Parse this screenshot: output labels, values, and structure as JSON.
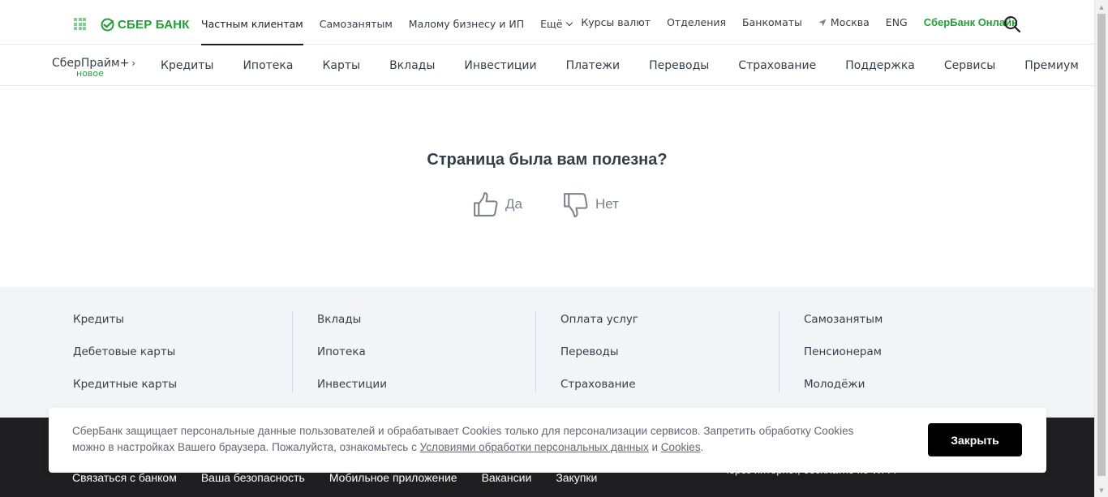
{
  "colors": {
    "brand_green": "#21a038",
    "text": "#333f48",
    "footer_bg": "#f2f4f7",
    "dark_footer_bg": "#1f1f22"
  },
  "header": {
    "logo_text": "СБЕР БАНК",
    "nav": [
      {
        "label": "Частным клиентам",
        "active": true
      },
      {
        "label": "Самозанятым"
      },
      {
        "label": "Малому бизнесу и ИП"
      },
      {
        "label": "Ещё"
      }
    ],
    "right": {
      "rates": "Курсы валют",
      "offices": "Отделения",
      "atms": "Банкоматы",
      "city": "Москва",
      "lang": "ENG",
      "online": "СберБанк Онлайн"
    },
    "icons": {
      "apps": "grid-icon",
      "search": "search-icon",
      "location": "location-arrow-icon"
    }
  },
  "product_nav": {
    "prime": "СберПрайм+",
    "prime_arrow": "›",
    "new_badge": "новое",
    "items": [
      "Кредиты",
      "Ипотека",
      "Карты",
      "Вклады",
      "Инвестиции",
      "Платежи",
      "Переводы",
      "Страхование",
      "Поддержка",
      "Сервисы",
      "Премиум"
    ]
  },
  "feedback": {
    "question": "Страница была вам полезна?",
    "yes": "Да",
    "no": "Нет"
  },
  "footer_links": {
    "columns": [
      [
        "Кредиты",
        "Дебетовые карты",
        "Кредитные карты"
      ],
      [
        "Вклады",
        "Ипотека",
        "Инвестиции"
      ],
      [
        "Оплата услуг",
        "Переводы",
        "Страхование"
      ],
      [
        "Самозанятым",
        "Пенсионерам",
        "Молодёжи"
      ]
    ]
  },
  "dark_footer": {
    "links": [
      "Связаться с банком",
      "Ваша безопасность",
      "Мобильное приложение",
      "Вакансии",
      "Закупки"
    ],
    "partial_text": "через интернет, бесплатно по Wi-Fi"
  },
  "cookie_banner": {
    "text_before": "СберБанк защищает персональные данные пользователей и обрабатывает Cookies только для персонализации сервисов. Запретить обработку Cookies можно в настройках Вашего браузера. Пожалуйста, ознакомьтесь с ",
    "link1": "Условиями обработки персональных данных",
    "middle": " и ",
    "link2": "Cookies",
    "end": ".",
    "close_label": "Закрыть"
  }
}
